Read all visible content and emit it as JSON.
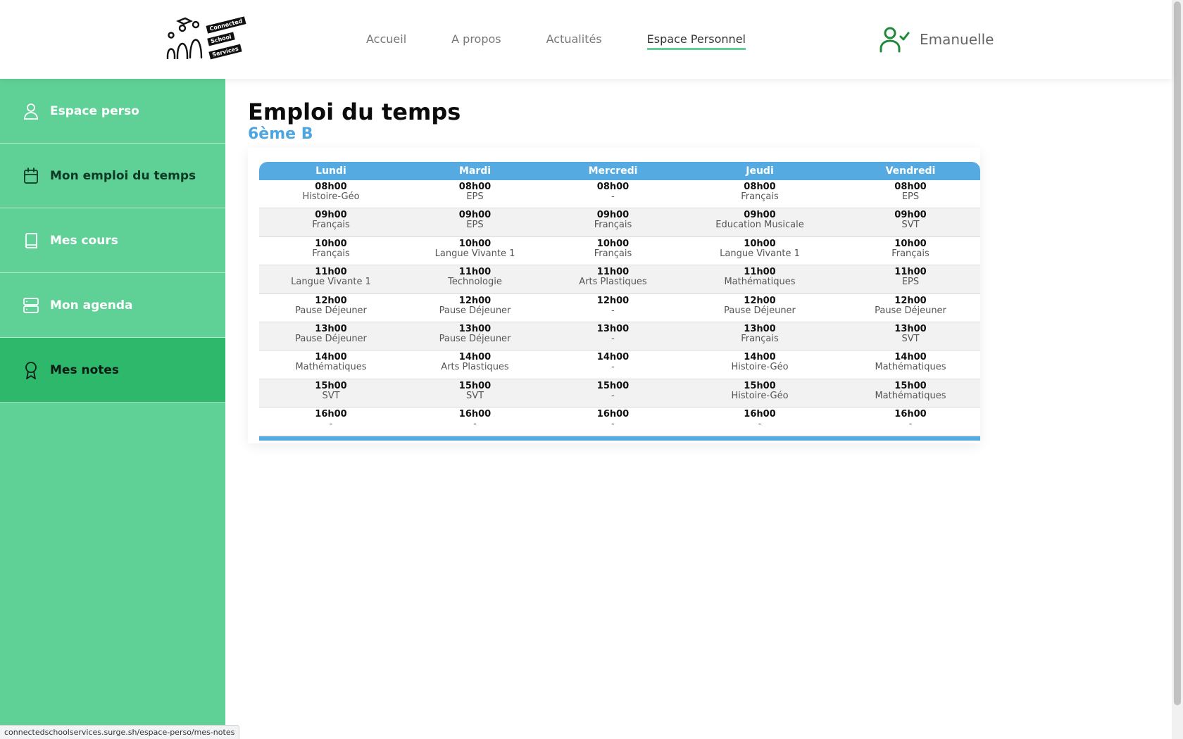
{
  "header": {
    "logo": {
      "line1": "Connected",
      "line2": "School",
      "line3": "Services"
    },
    "nav": [
      {
        "label": "Accueil"
      },
      {
        "label": "A propos"
      },
      {
        "label": "Actualités"
      },
      {
        "label": "Espace Personnel",
        "active": true
      }
    ],
    "user": {
      "name": "Emanuelle",
      "icon": "user-check-icon"
    }
  },
  "sidebar": {
    "items": [
      {
        "label": "Espace perso",
        "icon": "user-icon"
      },
      {
        "label": "Mon emploi du temps",
        "icon": "calendar-icon",
        "current": true
      },
      {
        "label": "Mes cours",
        "icon": "book-icon"
      },
      {
        "label": "Mon agenda",
        "icon": "server-icon"
      },
      {
        "label": "Mes notes",
        "icon": "award-icon",
        "active": true
      }
    ]
  },
  "main": {
    "title": "Emploi du temps",
    "subtitle": "6ème B",
    "timetable": {
      "days": [
        "Lundi",
        "Mardi",
        "Mercredi",
        "Jeudi",
        "Vendredi"
      ],
      "rows": [
        {
          "time": "08h00",
          "subjects": [
            "Histoire-Géo",
            "EPS",
            "-",
            "Français",
            "EPS"
          ]
        },
        {
          "time": "09h00",
          "subjects": [
            "Français",
            "EPS",
            "Français",
            "Education Musicale",
            "SVT"
          ]
        },
        {
          "time": "10h00",
          "subjects": [
            "Français",
            "Langue Vivante 1",
            "Français",
            "Langue Vivante 1",
            "Français"
          ]
        },
        {
          "time": "11h00",
          "subjects": [
            "Langue Vivante 1",
            "Technologie",
            "Arts Plastiques",
            "Mathématiques",
            "EPS"
          ]
        },
        {
          "time": "12h00",
          "subjects": [
            "Pause Déjeuner",
            "Pause Déjeuner",
            "-",
            "Pause Déjeuner",
            "Pause Déjeuner"
          ]
        },
        {
          "time": "13h00",
          "subjects": [
            "Pause Déjeuner",
            "Pause Déjeuner",
            "-",
            "Français",
            "SVT"
          ]
        },
        {
          "time": "14h00",
          "subjects": [
            "Mathématiques",
            "Arts Plastiques",
            "-",
            "Histoire-Géo",
            "Mathématiques"
          ]
        },
        {
          "time": "15h00",
          "subjects": [
            "SVT",
            "SVT",
            "-",
            "Histoire-Géo",
            "Mathématiques"
          ]
        },
        {
          "time": "16h00",
          "subjects": [
            "-",
            "-",
            "-",
            "-",
            "-"
          ]
        }
      ]
    }
  },
  "statusbar": {
    "url": "connectedschoolservices.surge.sh/espace-perso/mes-notes"
  },
  "colors": {
    "sidebar": "#5fd197",
    "sidebar_active": "#2eb86c",
    "table_header": "#55aae2",
    "subtitle": "#4ea6e0",
    "nav_underline": "#5fd197",
    "user_icon": "#1f8a3a"
  }
}
